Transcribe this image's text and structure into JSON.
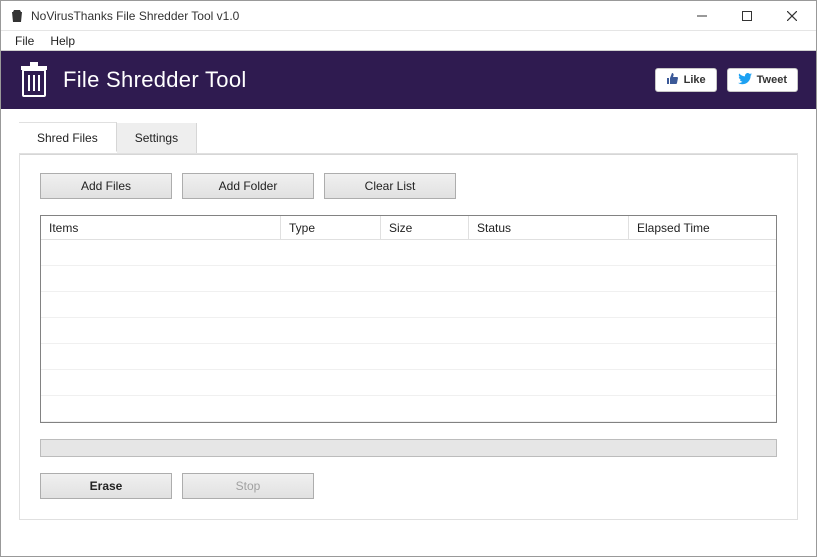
{
  "window": {
    "title": "NoVirusThanks File Shredder Tool v1.0"
  },
  "menubar": {
    "file": "File",
    "help": "Help"
  },
  "banner": {
    "title": "File Shredder Tool",
    "like_label": "Like",
    "tweet_label": "Tweet"
  },
  "tabs": {
    "shred_files": "Shred Files",
    "settings": "Settings"
  },
  "toolbar": {
    "add_files": "Add Files",
    "add_folder": "Add Folder",
    "clear_list": "Clear List"
  },
  "columns": {
    "items": "Items",
    "type": "Type",
    "size": "Size",
    "status": "Status",
    "elapsed": "Elapsed Time"
  },
  "actions": {
    "erase": "Erase",
    "stop": "Stop"
  }
}
